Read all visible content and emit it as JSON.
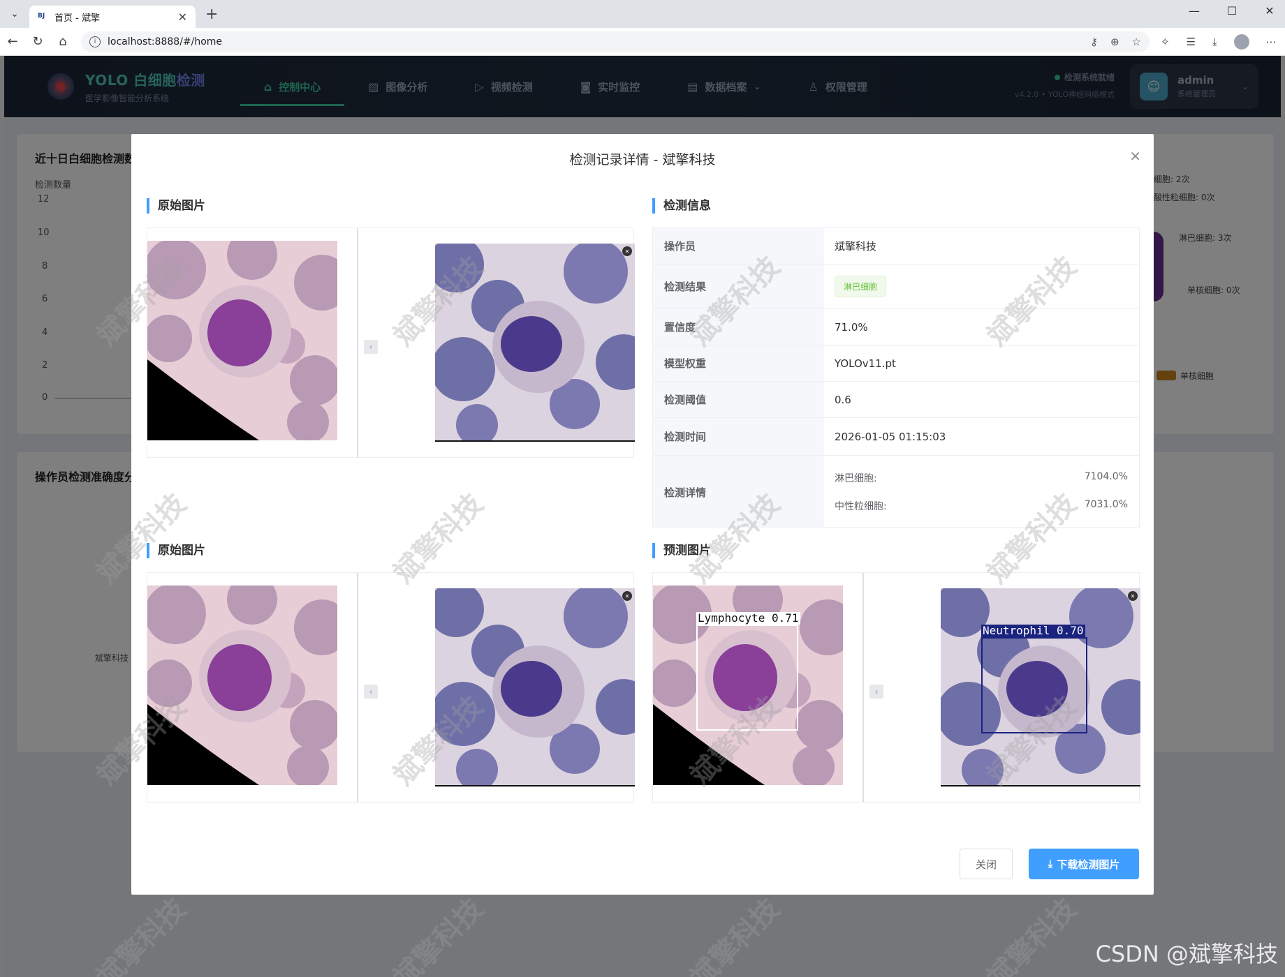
{
  "browser": {
    "tab_title": "首页 - 斌擎",
    "tab_favicon": "BJ",
    "url": "localhost:8888/#/home"
  },
  "header": {
    "brand_title_a": "YOLO 白细胞",
    "brand_title_b": "检测",
    "brand_subtitle": "医学影像智能分析系统",
    "menu": [
      {
        "label": "控制中心",
        "icon": "home-icon",
        "active": true
      },
      {
        "label": "图像分析",
        "icon": "image-icon"
      },
      {
        "label": "视频检测",
        "icon": "play-icon"
      },
      {
        "label": "实时监控",
        "icon": "camera-icon"
      },
      {
        "label": "数据档案",
        "icon": "document-icon"
      },
      {
        "label": "权限管理",
        "icon": "user-icon"
      }
    ],
    "status": "检测系统就绪",
    "version": "v4.2.0 • YOLO神经网络模式",
    "user_name": "admin",
    "user_role": "系统管理员"
  },
  "background": {
    "chart1_title": "近十日白细胞检测数",
    "chart1_ylabel": "检测数量",
    "chart1_yticks": [
      "12",
      "10",
      "8",
      "6",
      "4",
      "2",
      "0"
    ],
    "chart2_title": "操作员检测准确度分",
    "chart2_operator": "斌擎科技",
    "pie_labels": [
      "细胞: 2次",
      "酸性粒细胞: 0次",
      "淋巴细胞: 3次",
      "单核细胞: 0次"
    ],
    "legend_item": "单核细胞",
    "colors": {
      "legend": "#c8831e",
      "pie": "#6b2c91"
    }
  },
  "modal": {
    "title": "检测记录详情 - 斌擎科技",
    "section_original_top": "原始图片",
    "section_info": "检测信息",
    "section_original_bottom": "原始图片",
    "section_predicted": "预测图片",
    "info": {
      "operator_label": "操作员",
      "operator_value": "斌擎科技",
      "result_label": "检测结果",
      "result_value": "淋巴细胞",
      "confidence_label": "置信度",
      "confidence_value": "71.0%",
      "weights_label": "模型权重",
      "weights_value": "YOLOv11.pt",
      "threshold_label": "检测阈值",
      "threshold_value": "0.6",
      "time_label": "检测时间",
      "time_value": "2026-01-05 01:15:03",
      "details_label": "检测详情",
      "details": [
        {
          "name": "淋巴细胞:",
          "value": "7104.0%"
        },
        {
          "name": "中性粒细胞:",
          "value": "7031.0%"
        }
      ]
    },
    "detections": {
      "lymphocyte_label": "Lymphocyte  0.71",
      "neutrophil_label": "Neutrophil  0.70"
    },
    "close_button": "关闭",
    "download_button": "下载检测图片"
  },
  "watermark_text": "斌擎科技",
  "csdn_mark": "CSDN @斌擎科技"
}
